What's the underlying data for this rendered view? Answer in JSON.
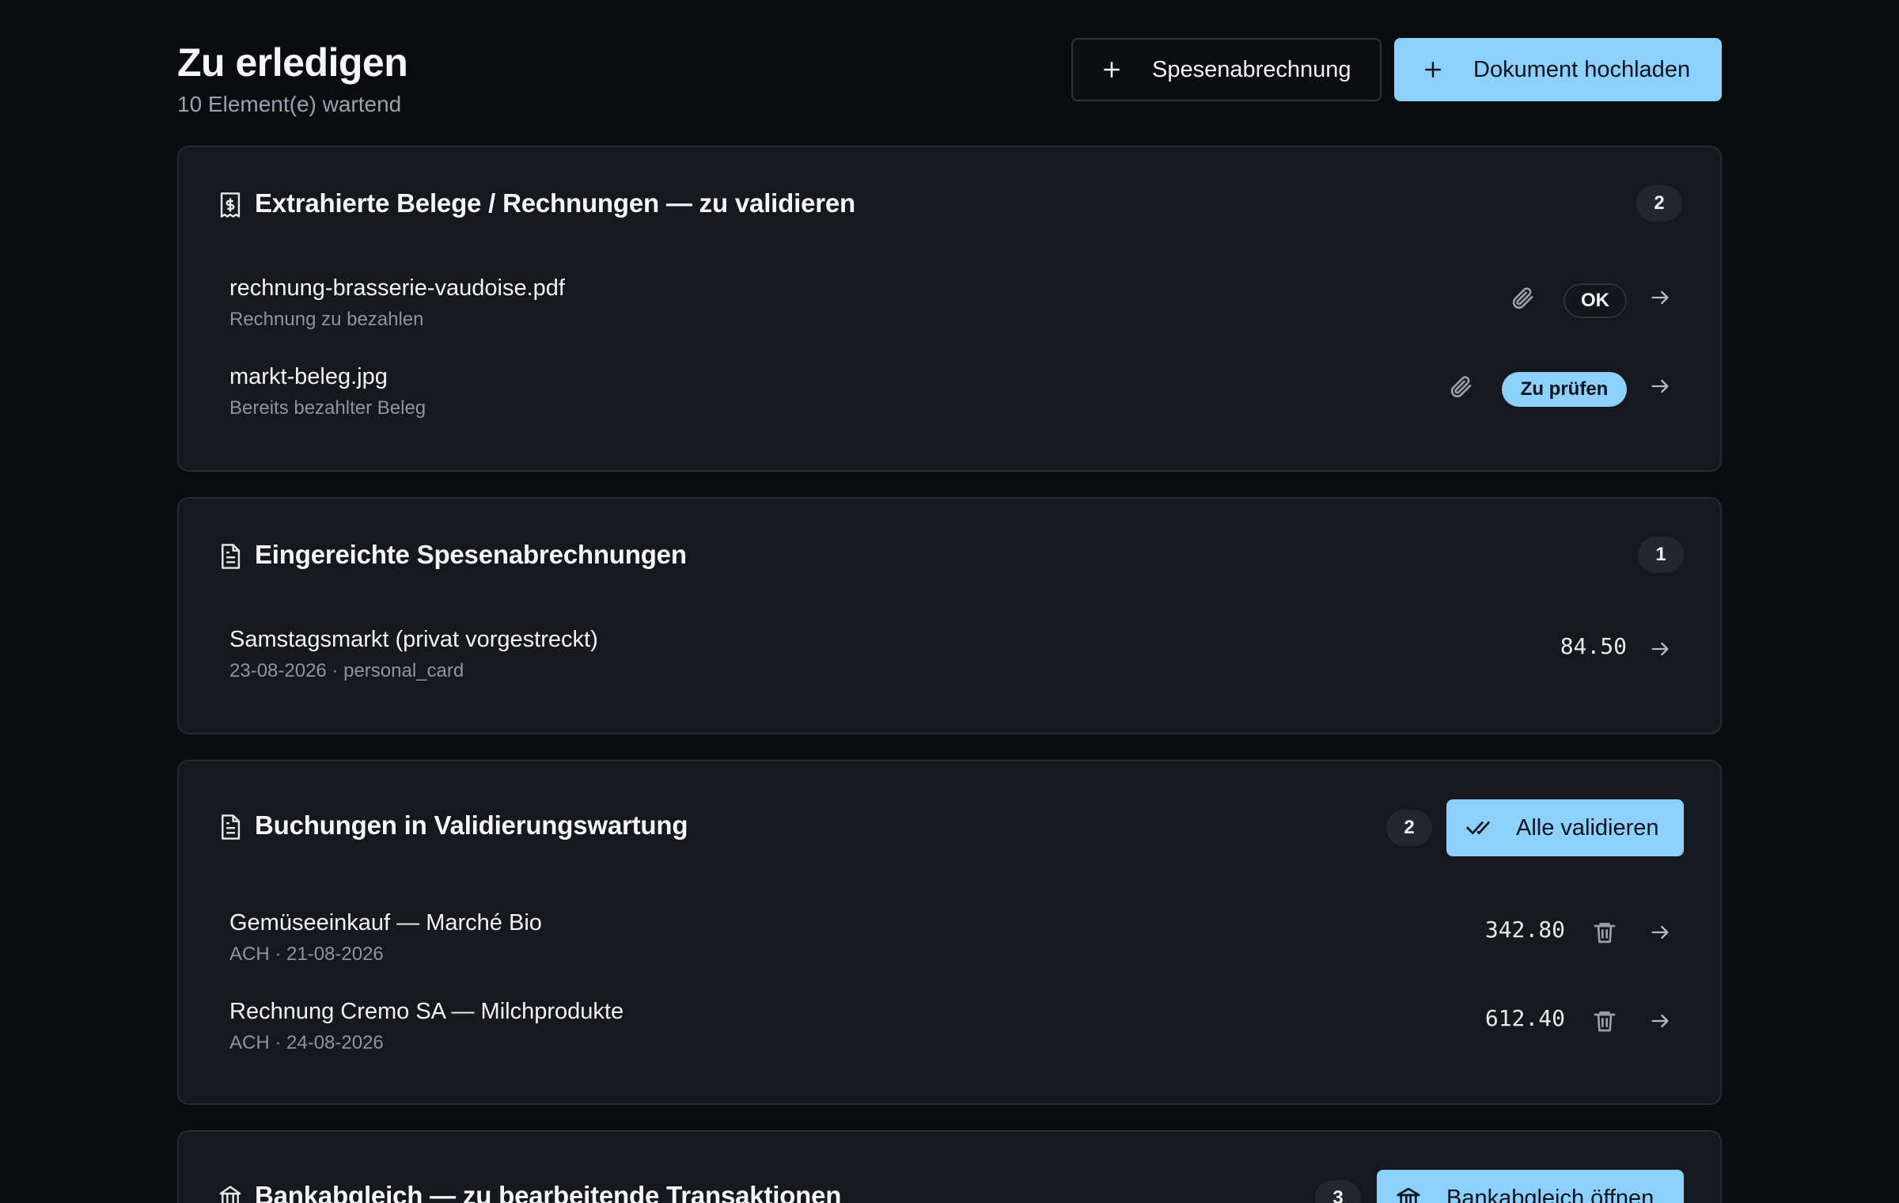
{
  "header": {
    "title": "Zu erledigen",
    "subtitle": "10 Element(e) wartend",
    "btn_expense": "Spesenabrechnung",
    "btn_upload": "Dokument hochladen"
  },
  "sections": {
    "receipts": {
      "title": "Extrahierte Belege / Rechnungen — zu validieren",
      "count": "2",
      "items": [
        {
          "title": "rechnung-brasserie-vaudoise.pdf",
          "sub": "Rechnung zu bezahlen",
          "status": "OK"
        },
        {
          "title": "markt-beleg.jpg",
          "sub": "Bereits bezahlter Beleg",
          "status": "Zu prüfen"
        }
      ]
    },
    "expenses": {
      "title": "Eingereichte Spesenabrechnungen",
      "count": "1",
      "items": [
        {
          "title": "Samstagsmarkt (privat vorgestreckt)",
          "sub": "23-08-2026 · personal_card",
          "amount": "84.50"
        }
      ]
    },
    "bookings": {
      "title": "Buchungen in Validierungswartung",
      "count": "2",
      "action": "Alle validieren",
      "items": [
        {
          "title": "Gemüseeinkauf — Marché Bio",
          "sub": "ACH · 21-08-2026",
          "amount": "342.80"
        },
        {
          "title": "Rechnung Cremo SA — Milchprodukte",
          "sub": "ACH · 24-08-2026",
          "amount": "612.40"
        }
      ]
    },
    "bank": {
      "title": "Bankabgleich — zu bearbeitende Transaktionen",
      "count": "3",
      "action": "Bankabgleich öffnen"
    }
  },
  "colors": {
    "background": "#0b0c0f",
    "card": "#16181e",
    "accent": "#8dd0fb"
  }
}
